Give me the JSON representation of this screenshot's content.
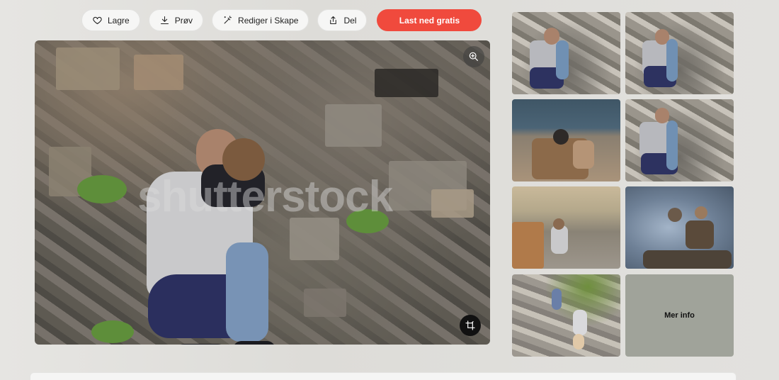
{
  "toolbar": {
    "save": {
      "label": "Lagre",
      "icon": "heart-icon"
    },
    "try": {
      "label": "Prøv",
      "icon": "download-icon"
    },
    "edit": {
      "label": "Rediger i Skape",
      "icon": "magic-wand-icon"
    },
    "share": {
      "label": "Del",
      "icon": "share-icon"
    },
    "download_label": "Last ned gratis",
    "download_color": "#f04a3d"
  },
  "main_image": {
    "watermark": "shutterstock",
    "zoom_icon": "zoom-in-icon",
    "crop_icon": "crop-icon"
  },
  "related": {
    "more_info_label": "Mer info"
  }
}
